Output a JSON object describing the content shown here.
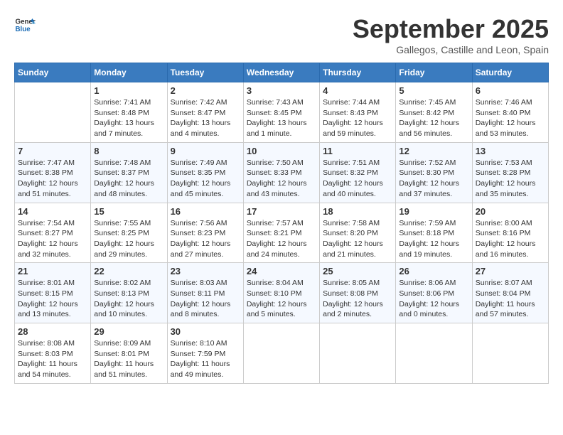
{
  "header": {
    "logo_line1": "General",
    "logo_line2": "Blue",
    "month": "September 2025",
    "location": "Gallegos, Castille and Leon, Spain"
  },
  "weekdays": [
    "Sunday",
    "Monday",
    "Tuesday",
    "Wednesday",
    "Thursday",
    "Friday",
    "Saturday"
  ],
  "weeks": [
    [
      {
        "day": "",
        "content": ""
      },
      {
        "day": "1",
        "content": "Sunrise: 7:41 AM\nSunset: 8:48 PM\nDaylight: 13 hours\nand 7 minutes."
      },
      {
        "day": "2",
        "content": "Sunrise: 7:42 AM\nSunset: 8:47 PM\nDaylight: 13 hours\nand 4 minutes."
      },
      {
        "day": "3",
        "content": "Sunrise: 7:43 AM\nSunset: 8:45 PM\nDaylight: 13 hours\nand 1 minute."
      },
      {
        "day": "4",
        "content": "Sunrise: 7:44 AM\nSunset: 8:43 PM\nDaylight: 12 hours\nand 59 minutes."
      },
      {
        "day": "5",
        "content": "Sunrise: 7:45 AM\nSunset: 8:42 PM\nDaylight: 12 hours\nand 56 minutes."
      },
      {
        "day": "6",
        "content": "Sunrise: 7:46 AM\nSunset: 8:40 PM\nDaylight: 12 hours\nand 53 minutes."
      }
    ],
    [
      {
        "day": "7",
        "content": "Sunrise: 7:47 AM\nSunset: 8:38 PM\nDaylight: 12 hours\nand 51 minutes."
      },
      {
        "day": "8",
        "content": "Sunrise: 7:48 AM\nSunset: 8:37 PM\nDaylight: 12 hours\nand 48 minutes."
      },
      {
        "day": "9",
        "content": "Sunrise: 7:49 AM\nSunset: 8:35 PM\nDaylight: 12 hours\nand 45 minutes."
      },
      {
        "day": "10",
        "content": "Sunrise: 7:50 AM\nSunset: 8:33 PM\nDaylight: 12 hours\nand 43 minutes."
      },
      {
        "day": "11",
        "content": "Sunrise: 7:51 AM\nSunset: 8:32 PM\nDaylight: 12 hours\nand 40 minutes."
      },
      {
        "day": "12",
        "content": "Sunrise: 7:52 AM\nSunset: 8:30 PM\nDaylight: 12 hours\nand 37 minutes."
      },
      {
        "day": "13",
        "content": "Sunrise: 7:53 AM\nSunset: 8:28 PM\nDaylight: 12 hours\nand 35 minutes."
      }
    ],
    [
      {
        "day": "14",
        "content": "Sunrise: 7:54 AM\nSunset: 8:27 PM\nDaylight: 12 hours\nand 32 minutes."
      },
      {
        "day": "15",
        "content": "Sunrise: 7:55 AM\nSunset: 8:25 PM\nDaylight: 12 hours\nand 29 minutes."
      },
      {
        "day": "16",
        "content": "Sunrise: 7:56 AM\nSunset: 8:23 PM\nDaylight: 12 hours\nand 27 minutes."
      },
      {
        "day": "17",
        "content": "Sunrise: 7:57 AM\nSunset: 8:21 PM\nDaylight: 12 hours\nand 24 minutes."
      },
      {
        "day": "18",
        "content": "Sunrise: 7:58 AM\nSunset: 8:20 PM\nDaylight: 12 hours\nand 21 minutes."
      },
      {
        "day": "19",
        "content": "Sunrise: 7:59 AM\nSunset: 8:18 PM\nDaylight: 12 hours\nand 19 minutes."
      },
      {
        "day": "20",
        "content": "Sunrise: 8:00 AM\nSunset: 8:16 PM\nDaylight: 12 hours\nand 16 minutes."
      }
    ],
    [
      {
        "day": "21",
        "content": "Sunrise: 8:01 AM\nSunset: 8:15 PM\nDaylight: 12 hours\nand 13 minutes."
      },
      {
        "day": "22",
        "content": "Sunrise: 8:02 AM\nSunset: 8:13 PM\nDaylight: 12 hours\nand 10 minutes."
      },
      {
        "day": "23",
        "content": "Sunrise: 8:03 AM\nSunset: 8:11 PM\nDaylight: 12 hours\nand 8 minutes."
      },
      {
        "day": "24",
        "content": "Sunrise: 8:04 AM\nSunset: 8:10 PM\nDaylight: 12 hours\nand 5 minutes."
      },
      {
        "day": "25",
        "content": "Sunrise: 8:05 AM\nSunset: 8:08 PM\nDaylight: 12 hours\nand 2 minutes."
      },
      {
        "day": "26",
        "content": "Sunrise: 8:06 AM\nSunset: 8:06 PM\nDaylight: 12 hours\nand 0 minutes."
      },
      {
        "day": "27",
        "content": "Sunrise: 8:07 AM\nSunset: 8:04 PM\nDaylight: 11 hours\nand 57 minutes."
      }
    ],
    [
      {
        "day": "28",
        "content": "Sunrise: 8:08 AM\nSunset: 8:03 PM\nDaylight: 11 hours\nand 54 minutes."
      },
      {
        "day": "29",
        "content": "Sunrise: 8:09 AM\nSunset: 8:01 PM\nDaylight: 11 hours\nand 51 minutes."
      },
      {
        "day": "30",
        "content": "Sunrise: 8:10 AM\nSunset: 7:59 PM\nDaylight: 11 hours\nand 49 minutes."
      },
      {
        "day": "",
        "content": ""
      },
      {
        "day": "",
        "content": ""
      },
      {
        "day": "",
        "content": ""
      },
      {
        "day": "",
        "content": ""
      }
    ]
  ]
}
